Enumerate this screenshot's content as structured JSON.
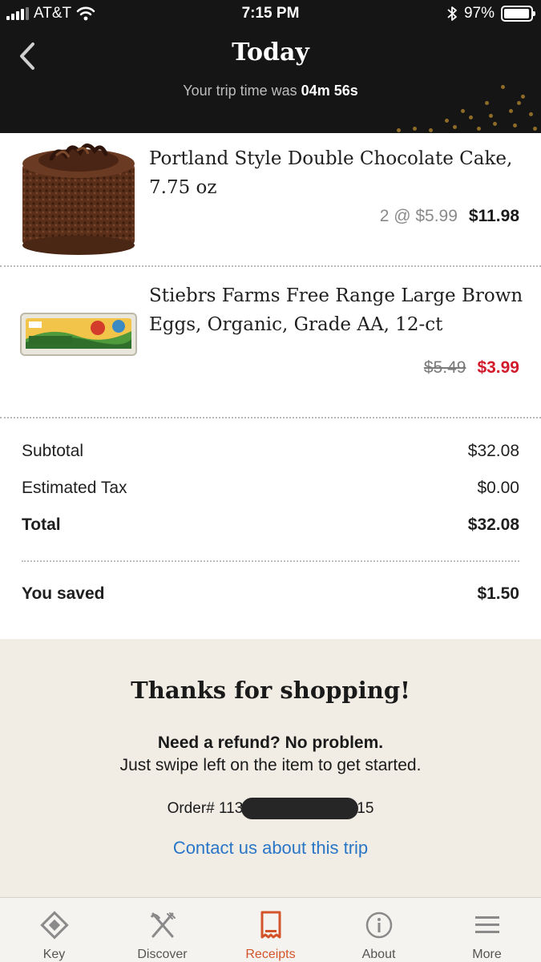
{
  "status_bar": {
    "carrier": "AT&T",
    "time": "7:15 PM",
    "battery": "97%"
  },
  "header": {
    "title": "Today",
    "trip_time_prefix": "Your trip time was",
    "trip_time_value": "04m 56s"
  },
  "items": [
    {
      "name": "Portland Style Double Chocolate Cake, 7.75 oz",
      "qty_at": "2 @ $5.99",
      "line_total": "$11.98"
    },
    {
      "name": "Stiebrs Farms Free Range Large Brown Eggs, Organic, Grade AA, 12-ct",
      "original_price": "$5.49",
      "sale_price": "$3.99"
    }
  ],
  "totals": {
    "subtotal_label": "Subtotal",
    "subtotal": "$32.08",
    "tax_label": "Estimated Tax",
    "tax": "$0.00",
    "total_label": "Total",
    "total": "$32.08",
    "saved_label": "You saved",
    "saved": "$1.50"
  },
  "thanks": {
    "title": "Thanks for shopping!",
    "refund_question": "Need a refund? No problem.",
    "refund_hint": "Just swipe left on the item to get started.",
    "order_prefix": "Order# 113",
    "order_suffix": "15",
    "contact_link": "Contact us about this trip"
  },
  "tabs": [
    {
      "label": "Key",
      "icon": "key-diamond-icon"
    },
    {
      "label": "Discover",
      "icon": "fork-knife-icon"
    },
    {
      "label": "Receipts",
      "icon": "receipt-icon",
      "active": true
    },
    {
      "label": "About",
      "icon": "info-icon"
    },
    {
      "label": "More",
      "icon": "menu-icon"
    }
  ],
  "colors": {
    "accent": "#d3542a",
    "sale": "#d11a2a",
    "link": "#2a76c6",
    "header_bg": "#151515"
  }
}
